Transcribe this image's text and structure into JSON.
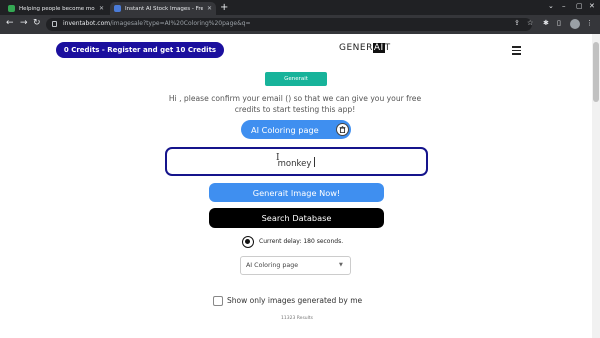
{
  "browser": {
    "tabs": [
      {
        "title": "Helping people become more cr"
      },
      {
        "title": "Instant AI Stock Images - Free In"
      }
    ],
    "new_tab": "+",
    "url_host": "inventabot.com",
    "url_path": "/imagesale?type=AI%20Coloring%20page&q="
  },
  "header": {
    "credits_label": "0 Credits - Register and get 10 Credits",
    "logo_pre": "GENER",
    "logo_ai": "AI",
    "logo_post": "T"
  },
  "main": {
    "badge": "Generait",
    "confirm_message": "Hi , please confirm your email () so that we can give you your free credits to start testing this app!",
    "model_name": "AI Coloring page",
    "prompt_value": "monkey",
    "generate_label": "Generait Image Now!",
    "search_label": "Search Database",
    "delay_text": "Current delay: 180 seconds.",
    "select_value": "AI Coloring page",
    "checkbox_label": "Show only images generated by me",
    "checkbox_checked": false,
    "results_text": "11323 Results"
  },
  "colors": {
    "credits_bg": "#1b0f9e",
    "teal_badge": "#17b39a",
    "primary_blue": "#3f8ff0",
    "input_border": "#15148c"
  },
  "icons": [
    "lock-icon",
    "trash-icon",
    "timer-icon",
    "chevron-down-icon",
    "menu-icon"
  ]
}
